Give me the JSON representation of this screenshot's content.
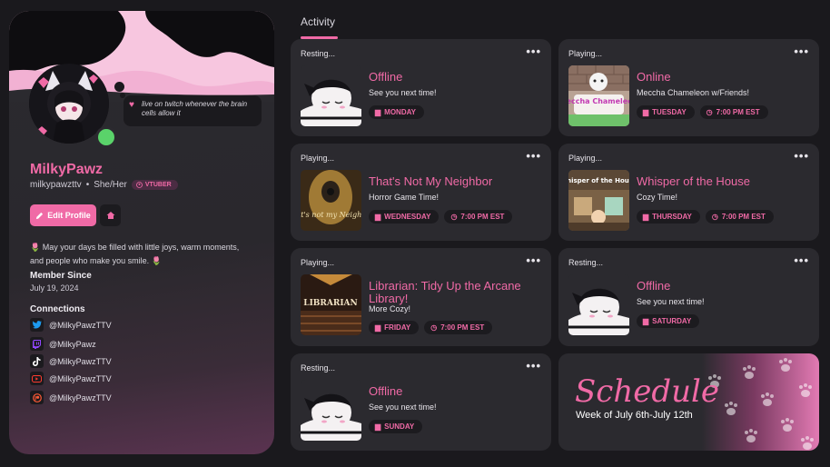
{
  "profile": {
    "name": "MilkyPawz",
    "handle": "milkypawzttv",
    "pronouns": "She/Her",
    "badge": "VTUBER",
    "status": "live on twitch whenever the brain cells allow it",
    "edit_label": "Edit Profile",
    "bio": "🌷 May your days be filled with little joys, warm moments, and people who make you smile. 🌷",
    "member_since_label": "Member Since",
    "member_since": "July 19, 2024",
    "connections_label": "Connections",
    "connections": [
      {
        "service": "twitter-icon",
        "label": "@MilkyPawzTTV",
        "color": "#1d9bf0"
      },
      {
        "service": "twitch-icon",
        "label": "@MilkyPawz",
        "color": "#9146ff"
      },
      {
        "service": "tiktok-icon",
        "label": "@MilkyPawzTTV",
        "color": "#ffffff"
      },
      {
        "service": "youtube-icon",
        "label": "@MilkyPawzTTV",
        "color": "#ff3b30"
      },
      {
        "service": "patreon-icon",
        "label": "@MilkyPawzTTV",
        "color": "#ff5a36"
      }
    ]
  },
  "activity": {
    "tab": "Activity",
    "cards": [
      {
        "state": "Resting...",
        "title": "Offline",
        "desc": "See you next time!",
        "day": "MONDAY",
        "time": ""
      },
      {
        "state": "Playing...",
        "title": "Online",
        "desc": "Meccha Chameleon w/Friends!",
        "day": "TUESDAY",
        "time": "7:00 PM EST"
      },
      {
        "state": "Playing...",
        "title": "That's Not My Neighbor",
        "desc": "Horror Game Time!",
        "day": "WEDNESDAY",
        "time": "7:00 PM EST"
      },
      {
        "state": "Playing...",
        "title": "Whisper of the House",
        "desc": "Cozy Time!",
        "day": "THURSDAY",
        "time": "7:00 PM EST"
      },
      {
        "state": "Playing...",
        "title": "Librarian: Tidy Up the Arcane Library!",
        "desc": "More Cozy!",
        "day": "FRIDAY",
        "time": "7:00 PM EST"
      },
      {
        "state": "Resting...",
        "title": "Offline",
        "desc": "See you next time!",
        "day": "SATURDAY",
        "time": ""
      },
      {
        "state": "Resting...",
        "title": "Offline",
        "desc": "See you next time!",
        "day": "SUNDAY",
        "time": ""
      }
    ],
    "thumb_text": {
      "meccha": "Meccha Chameleon",
      "neighbor": "That's not my Neighbor",
      "whisper": "Whisper of the House",
      "librarian": "LIBRARIAN"
    }
  },
  "schedule": {
    "title": "Schedule",
    "week": "Week of July 6th-July 12th"
  },
  "accent": "#f06aa6"
}
